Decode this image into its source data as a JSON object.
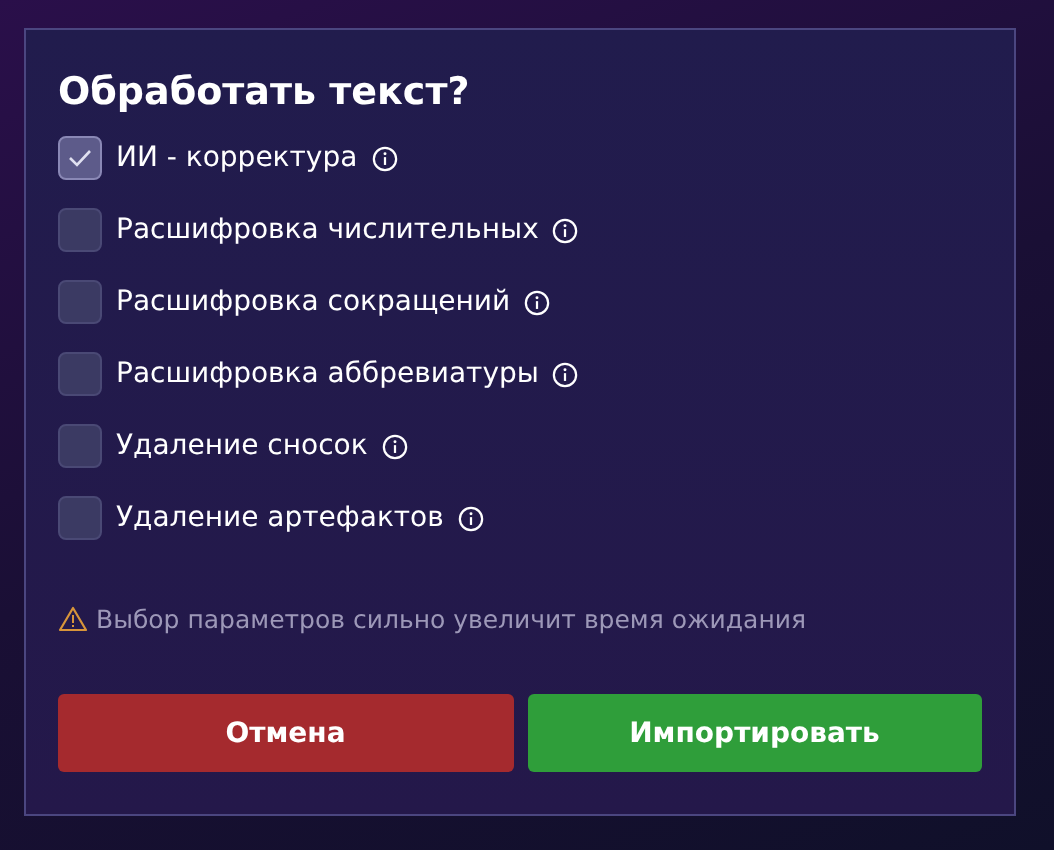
{
  "dialog": {
    "title": "Обработать текст?",
    "options": [
      {
        "label": "ИИ - корректура",
        "checked": true
      },
      {
        "label": "Расшифровка числительных",
        "checked": false
      },
      {
        "label": "Расшифровка сокращений",
        "checked": false
      },
      {
        "label": "Расшифровка аббревиатуры",
        "checked": false
      },
      {
        "label": "Удаление сносок",
        "checked": false
      },
      {
        "label": "Удаление артефактов",
        "checked": false
      }
    ],
    "warning": "Выбор параметров сильно увеличит время ожидания",
    "buttons": [
      {
        "label": "Отмена",
        "kind": "cancel"
      },
      {
        "label": "Импортировать",
        "kind": "confirm"
      }
    ]
  }
}
